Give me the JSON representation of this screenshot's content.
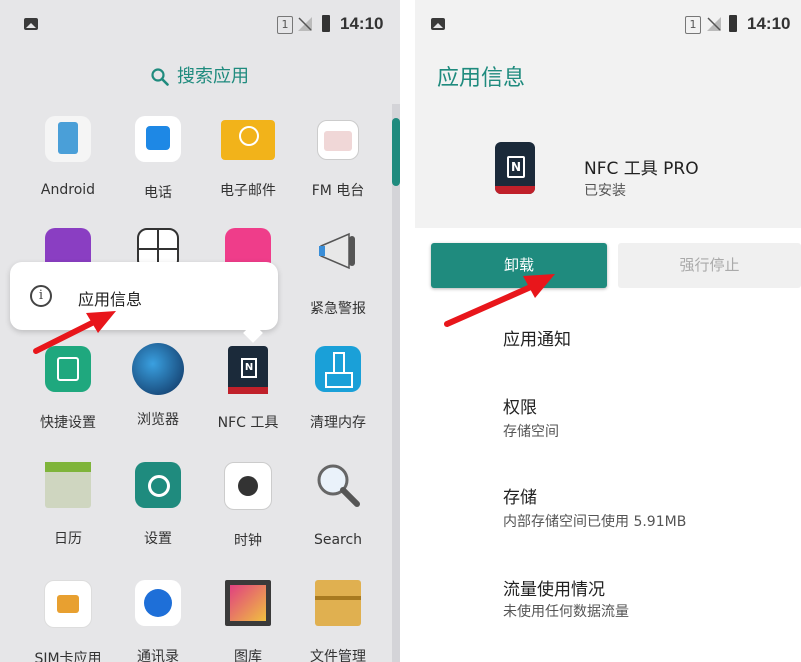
{
  "left": {
    "status": {
      "sim": "1",
      "time": "14:10"
    },
    "search_label": "搜索应用",
    "apps": [
      {
        "label": "Android",
        "icon": "keyboard-icon",
        "color": "#4a9fd8"
      },
      {
        "label": "电话",
        "icon": "phone-icon",
        "color": "#1e88e5"
      },
      {
        "label": "电子邮件",
        "icon": "email-icon",
        "color": "#f2b31a"
      },
      {
        "label": "FM 电台",
        "icon": "radio-icon",
        "color": "#e9e9e9"
      },
      {
        "label": "",
        "icon": "contacts-purple-icon",
        "color": "#8a3ec2"
      },
      {
        "label": "",
        "icon": "grid-app-icon",
        "color": "#ffffff"
      },
      {
        "label": "",
        "icon": "pink-app-icon",
        "color": "#ef3d8a"
      },
      {
        "label": "紧急警报",
        "icon": "megaphone-icon",
        "color": "#f5f5f5"
      },
      {
        "label": "快捷设置",
        "icon": "quick-settings-icon",
        "color": "#1fa87e"
      },
      {
        "label": "浏览器",
        "icon": "globe-icon",
        "color": "#1a4f8a"
      },
      {
        "label": "NFC 工具",
        "icon": "nfc-tools-icon",
        "color": "#1b2a3a"
      },
      {
        "label": "清理内存",
        "icon": "broom-icon",
        "color": "#1aa0d8"
      },
      {
        "label": "日历",
        "icon": "calendar-icon",
        "color": "#cfd6c0"
      },
      {
        "label": "设置",
        "icon": "settings-gear-icon",
        "color": "#1f8b7e"
      },
      {
        "label": "时钟",
        "icon": "clock-icon",
        "color": "#f5f5f5"
      },
      {
        "label": "Search",
        "icon": "magnifier-icon",
        "color": "#e8f0f8"
      },
      {
        "label": "SIM卡应用",
        "icon": "sim-app-icon",
        "color": "#e8e8e8"
      },
      {
        "label": "通讯录",
        "icon": "contacts-icon",
        "color": "#1e6fd8"
      },
      {
        "label": "图库",
        "icon": "gallery-icon",
        "color": "#3a3a3a"
      },
      {
        "label": "文件管理",
        "icon": "file-manager-icon",
        "color": "#e0b050"
      }
    ],
    "popup": {
      "label": "应用信息"
    }
  },
  "right": {
    "status": {
      "sim": "1",
      "time": "14:10"
    },
    "title": "应用信息",
    "app_name": "NFC 工具 PRO",
    "app_status": "已安装",
    "uninstall": "卸载",
    "force_stop": "强行停止",
    "rows": [
      {
        "title": "应用通知",
        "subtitle": ""
      },
      {
        "title": "权限",
        "subtitle": "存储空间"
      },
      {
        "title": "存储",
        "subtitle": "内部存储空间已使用 5.91MB"
      },
      {
        "title": "流量使用情况",
        "subtitle": "未使用任何数据流量"
      }
    ]
  },
  "colors": {
    "accent": "#1f8b7e",
    "arrow": "#e8161b"
  }
}
